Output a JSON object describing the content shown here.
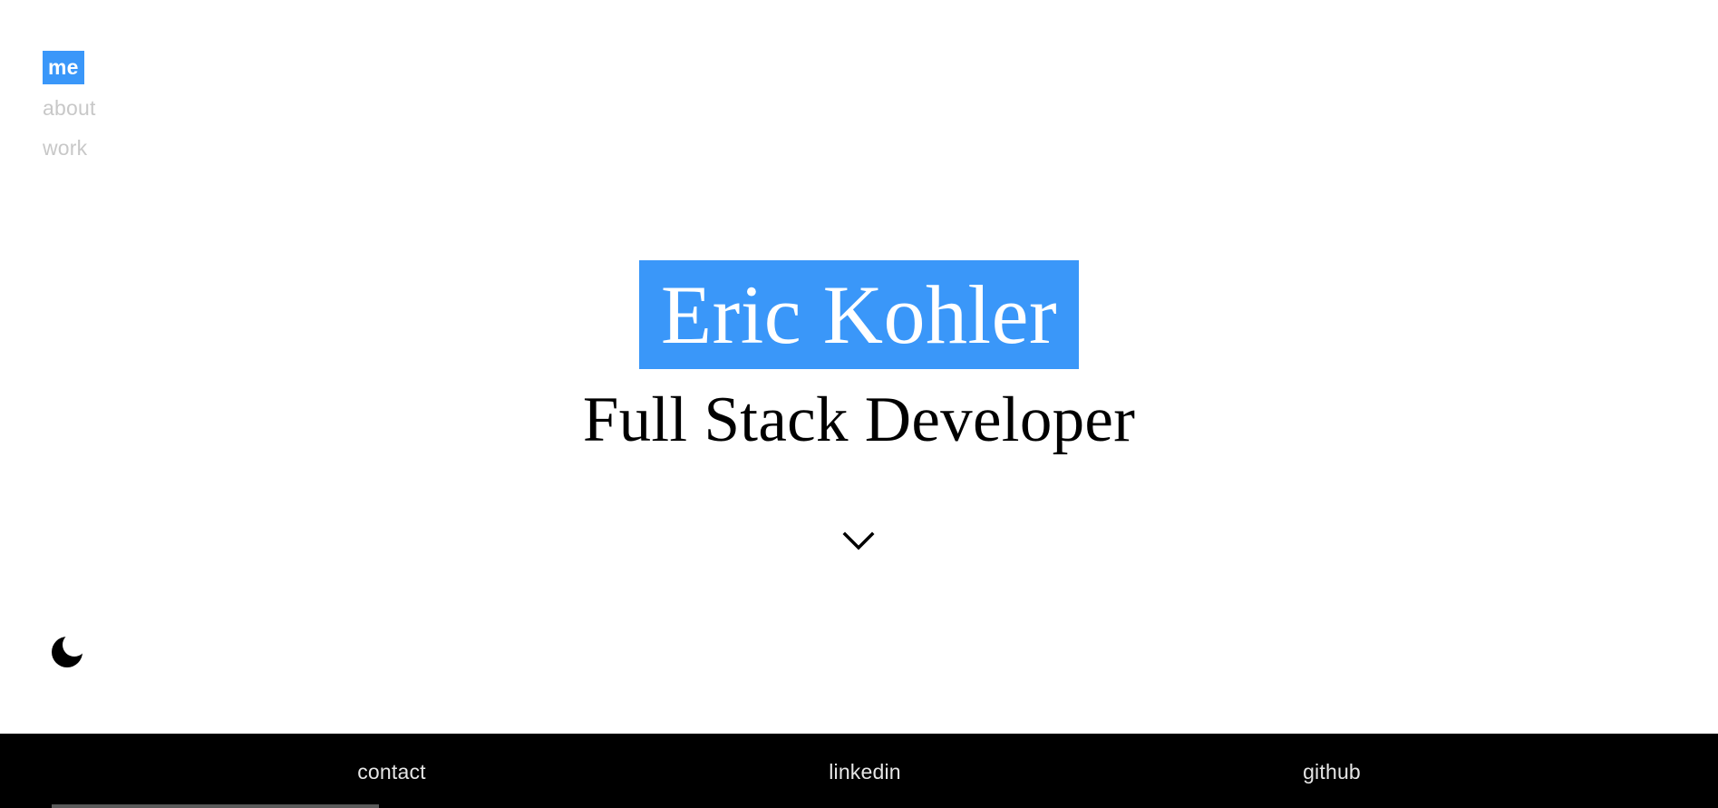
{
  "nav": {
    "items": [
      {
        "label": "me",
        "active": true
      },
      {
        "label": "about",
        "active": false
      },
      {
        "label": "work",
        "active": false
      }
    ]
  },
  "hero": {
    "name": "Eric Kohler",
    "role": "Full Stack Developer"
  },
  "icons": {
    "scroll": "chevron-down-icon",
    "theme": "moon-icon"
  },
  "footer": {
    "links": [
      {
        "label": "contact"
      },
      {
        "label": "linkedin"
      },
      {
        "label": "github"
      }
    ]
  },
  "colors": {
    "accent": "#3a97f9",
    "nav_inactive": "#c8c8c8",
    "footer_bg": "#000000",
    "footer_text": "#e6e6e6"
  }
}
